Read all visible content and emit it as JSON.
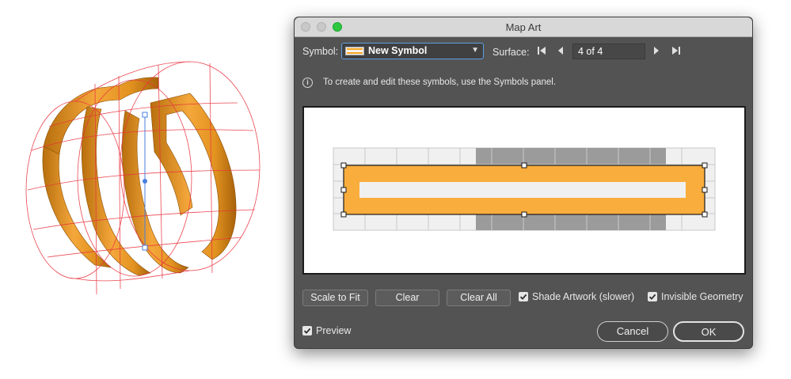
{
  "dialog": {
    "title": "Map Art",
    "symbol_label": "Symbol:",
    "symbol_value": "New Symbol",
    "surface_label": "Surface:",
    "surface_value": "4 of 4",
    "info_text": "To create and edit these symbols, use the Symbols panel.",
    "buttons": {
      "scale_to_fit": "Scale to Fit",
      "clear": "Clear",
      "clear_all": "Clear All",
      "cancel": "Cancel",
      "ok": "OK"
    },
    "checkboxes": {
      "shade_artwork": {
        "label": "Shade Artwork (slower)",
        "checked": true
      },
      "invisible_geometry": {
        "label": "Invisible Geometry",
        "checked": true
      },
      "preview": {
        "label": "Preview",
        "checked": true
      }
    }
  },
  "icons": {
    "first": "skip-to-first-icon",
    "prev": "previous-icon",
    "next": "next-icon",
    "last": "skip-to-last-icon",
    "info": "info-icon",
    "dropdown": "chevron-down-icon"
  },
  "colors": {
    "accent": "#f5a623",
    "dialog_bg": "#535353",
    "mesh": "#e8333f",
    "selection": "#4a7fe0",
    "highlight_zone": "#9b9b9b",
    "focus": "#5d9fe0"
  }
}
